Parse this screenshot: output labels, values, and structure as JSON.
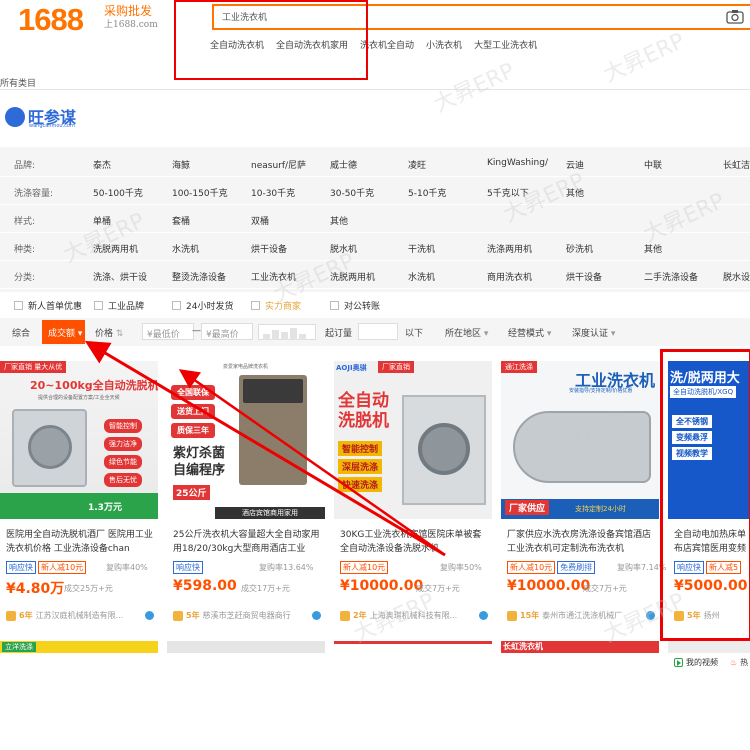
{
  "header": {
    "logo": "1688",
    "slogan": "采购批发",
    "domain": "上1688.com",
    "search_value": "工业洗衣机",
    "hot_words": [
      "全自动洗衣机",
      "全自动洗衣机家用",
      "洗衣机全自动",
      "小洗衣机",
      "大型工业洗衣机"
    ],
    "all_categories": "所有类目"
  },
  "plugin": {
    "name": "旺参谋",
    "sub": "wangcanmou.com"
  },
  "filters": [
    {
      "label": "品牌:",
      "options": [
        "泰杰",
        "海鲸",
        "neasurf/尼萨",
        "威士德",
        "凌旺",
        "KingWashing/",
        "云迪",
        "中联",
        "长虹洁"
      ]
    },
    {
      "label": "洗涤容量:",
      "options": [
        "50-100千克",
        "100-150千克",
        "10-30千克",
        "30-50千克",
        "5-10千克",
        "5千克以下",
        "其他"
      ]
    },
    {
      "label": "样式:",
      "options": [
        "单桶",
        "套桶",
        "双桶",
        "其他"
      ]
    },
    {
      "label": "种类:",
      "options": [
        "洗脱两用机",
        "水洗机",
        "烘干设备",
        "脱水机",
        "干洗机",
        "洗涤两用机",
        "砂洗机",
        "其他"
      ]
    },
    {
      "label": "分类:",
      "options": [
        "洗涤、烘干设",
        "整烫洗涤设备",
        "工业洗衣机",
        "洗脱两用机",
        "水洗机",
        "商用洗衣机",
        "烘干设备",
        "二手洗涤设备",
        "脱水设"
      ]
    }
  ],
  "checkboxes": [
    "新人首单优惠",
    "工业品牌",
    "24小时发货",
    "实力商家",
    "对公转账"
  ],
  "sortbar": {
    "comprehensive": "综合",
    "sales": "成交额",
    "price": "价格",
    "min_price": "¥最低价",
    "dash": "—",
    "max_price": "¥最高价",
    "moq": "起订量",
    "below": "以下",
    "region": "所在地区",
    "mode": "经营模式",
    "cert": "深度认证"
  },
  "products": [
    {
      "img_top": "厂家直销 量大从优",
      "img_title": "20~100kg全自动洗脱机",
      "img_sub": "提供合理的设备配置方案/工业全天候",
      "img_tags": [
        "智能控制",
        "强力洁净",
        "绿色节能",
        "售后无忧"
      ],
      "img_price": "1.3万元",
      "title": "医院用全自动洗脱机酒厂 医院用工业洗衣机价格 工业洗涤设备chan",
      "tags": [
        "响应快",
        "新人减10元"
      ],
      "right": "复购率40%",
      "price": "¥4.80万",
      "sold": "成交25万+元",
      "years": "6年",
      "shop": "江苏汉庭机械制造有限..."
    },
    {
      "img_top": "泉爱家电品牌洗衣机",
      "img_tags": [
        "全国联保",
        "送货上门",
        "质保三年"
      ],
      "img_big": "紫灯杀菌\n自编程序",
      "img_badge": "25公斤",
      "img_bottom": "酒店宾馆商用家用",
      "title": "25公斤洗衣机大容量超大全自动家用用18/20/30kg大型商用酒店工业",
      "tags": [
        "响应快"
      ],
      "right": "复购率13.64%",
      "price": "¥598.00",
      "sold": "成交17万+元",
      "years": "5年",
      "shop": "慈溪市芝赶商贸电器商行"
    },
    {
      "img_top": "AOJI奥骐",
      "img_tag": "厂家直销",
      "img_title": "全自动\n洗脱机",
      "img_tags": [
        "智能控制",
        "深层洗涤",
        "快速洗涤"
      ],
      "title": "30KG工业洗衣机宾馆医院床单被套全自动洗涤设备洗脱水机",
      "tags": [
        "新人减10元"
      ],
      "right": "复购率50%",
      "price": "¥10000.00",
      "sold": "成交7万+元",
      "years": "2年",
      "shop": "上海奥琪机械科技有限..."
    },
    {
      "img_top": "通江洗涤",
      "img_title": "工业洗衣机",
      "img_sub": "安装指导/支持定制/价格优惠",
      "img_bottom1": "厂家供应",
      "img_bottom2": "支持定制24小时",
      "title": "厂家供应水洗衣房洗涤设备宾馆酒店工业洗衣机可定制洗布洗衣机",
      "tags": [
        "新人减10元",
        "免费刷排"
      ],
      "right": "复购率7.14%",
      "price": "¥10000.00",
      "sold": "成交7万+元",
      "years": "15年",
      "shop": "泰州市通江洗涤机械厂"
    },
    {
      "img_title": "洗/脱两用大",
      "img_sub": "全自动洗脱机/XGQ",
      "img_tags": [
        "全不锈钢",
        "变频悬浮",
        "视频教学"
      ],
      "title": "全自动电加热床单布店宾馆医用变频工业",
      "tags": [
        "响应快",
        "新人减5"
      ],
      "price": "¥5000.00",
      "years": "5年",
      "shop": "扬州"
    }
  ],
  "bottom_labels": [
    "立洋洗涤",
    "长虹洗衣机"
  ],
  "footer": {
    "video": "我的视频",
    "hot": "热"
  },
  "watermark": "大昇ERP",
  "colors": {
    "brand": "#ff7300",
    "accent": "#ff5000",
    "blue": "#2e6bd8",
    "annotation": "#ee0000"
  }
}
